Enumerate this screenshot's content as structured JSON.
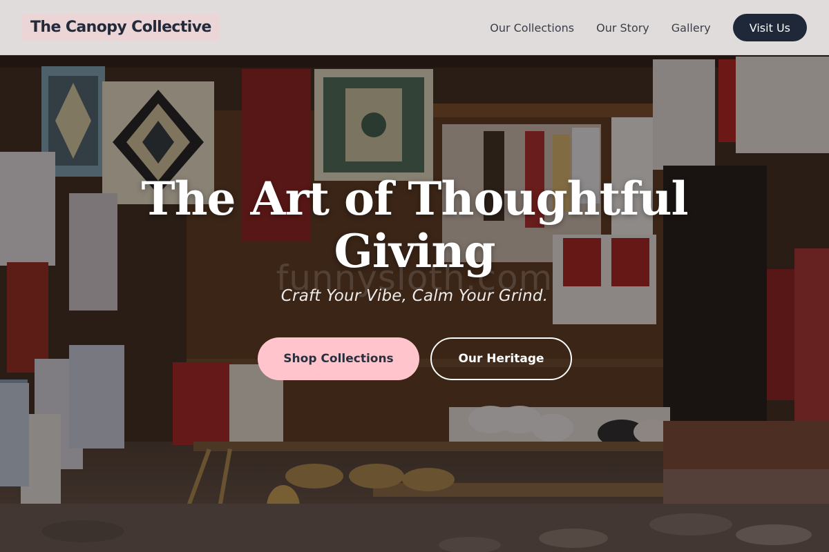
{
  "header": {
    "brand": "The Canopy Collective",
    "nav": [
      {
        "label": "Our Collections"
      },
      {
        "label": "Our Story"
      },
      {
        "label": "Gallery"
      }
    ],
    "cta_label": "Visit Us"
  },
  "hero": {
    "title": "The Art of Thoughtful Giving",
    "subtitle": "Craft Your Vibe, Calm Your Grind.",
    "watermark": "funnysloth.com",
    "primary_button": "Shop Collections",
    "secondary_button": "Our Heritage",
    "background_image": "market-stall-textiles-photo"
  },
  "colors": {
    "accent_pink": "#ffc4cc",
    "navy": "#1f2838",
    "header_bg": "#ece9e8"
  }
}
